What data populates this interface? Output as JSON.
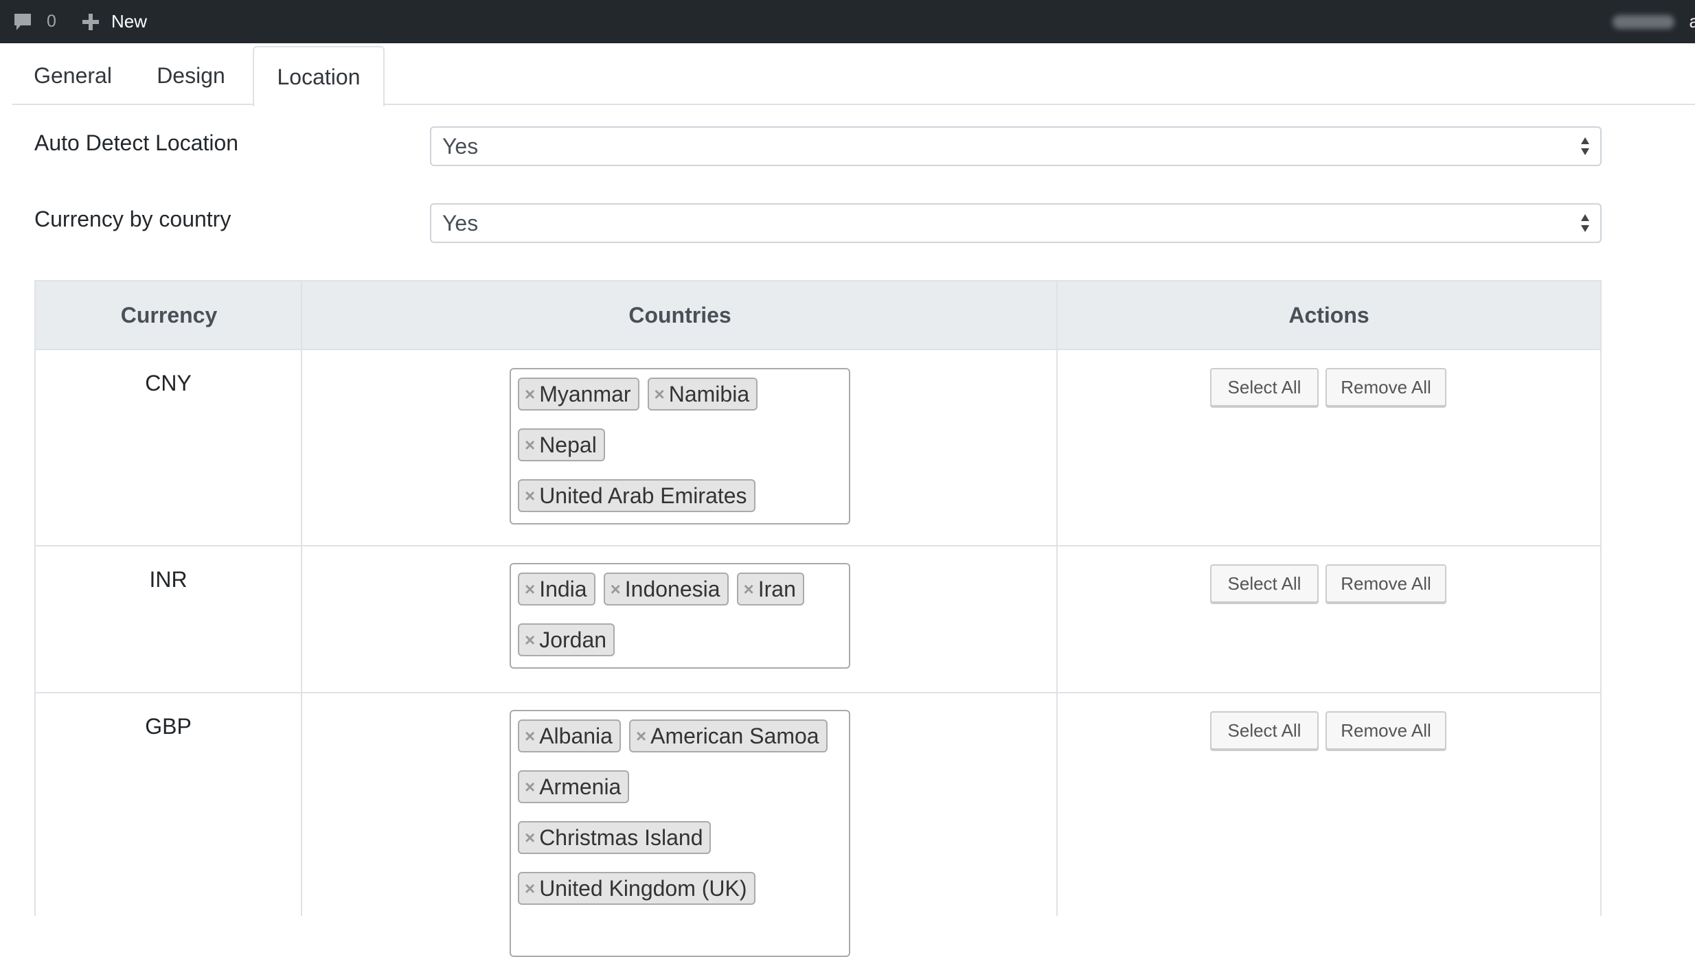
{
  "adminbar": {
    "comments_icon": "comment-bubble-icon",
    "comment_count": "0",
    "new_icon": "plus-icon",
    "new_label": "New",
    "howdy_tail": "a"
  },
  "tabs": [
    {
      "label": "General",
      "active": false
    },
    {
      "label": "Design",
      "active": false
    },
    {
      "label": "Location",
      "active": true
    }
  ],
  "fields": {
    "auto_detect": {
      "label": "Auto Detect Location",
      "value": "Yes"
    },
    "currency_by_country": {
      "label": "Currency by country",
      "value": "Yes"
    }
  },
  "table": {
    "headers": {
      "currency": "Currency",
      "countries": "Countries",
      "actions": "Actions"
    },
    "rows": [
      {
        "currency": "CNY",
        "countries": [
          "Myanmar",
          "Namibia",
          "Nepal",
          "United Arab Emirates"
        ]
      },
      {
        "currency": "INR",
        "countries": [
          "India",
          "Indonesia",
          "Iran",
          "Jordan"
        ]
      },
      {
        "currency": "GBP",
        "countries": [
          "Albania",
          "American Samoa",
          "Armenia",
          "Christmas Island",
          "United Kingdom (UK)"
        ]
      }
    ],
    "actions": {
      "select_all": "Select All",
      "remove_all": "Remove All"
    }
  },
  "colors": {
    "adminbar_bg": "#23282d",
    "header_bg": "#e9ecef",
    "chip_bg": "#e4e4e4",
    "border": "#dee2e6"
  }
}
